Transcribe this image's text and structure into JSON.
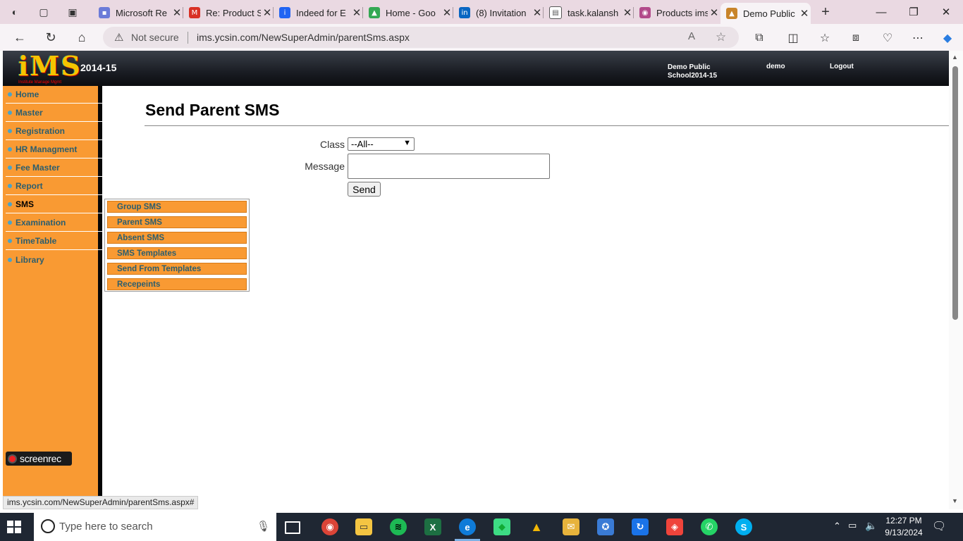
{
  "browser": {
    "tabs": [
      {
        "title": "Microsoft Re",
        "favicon_color": "#6b7bd8"
      },
      {
        "title": "Re: Product S",
        "favicon_color": "#d93025"
      },
      {
        "title": "Indeed for E",
        "favicon_color": "#2164f3"
      },
      {
        "title": "Home - Goo",
        "favicon_color": "#34a853"
      },
      {
        "title": "(8) Invitation",
        "favicon_color": "#0a66c2"
      },
      {
        "title": "task.kalansh",
        "favicon_color": "#555555"
      },
      {
        "title": "Products ims",
        "favicon_color": "#b24a8a"
      },
      {
        "title": "Demo Public",
        "favicon_color": "#c8842a"
      }
    ],
    "close_glyph": "✕",
    "new_tab_glyph": "+",
    "window_controls": {
      "minimize": "—",
      "restore": "❐",
      "close": "✕"
    },
    "address": {
      "warning_glyph": "⚠",
      "security_label": "Not secure",
      "url": "ims.ycsin.com/NewSuperAdmin/parentSms.aspx"
    },
    "nav_glyphs": {
      "back": "←",
      "refresh": "↻",
      "home": "⌂",
      "read_aloud": "A",
      "favorite": "☆"
    },
    "toolbar_glyphs": {
      "extensions": "⧉",
      "split": "◫",
      "favorites": "☆",
      "collections": "⧈",
      "performance": "♡",
      "more": "⋯",
      "copilot": "◆"
    },
    "status_url": "ims.ycsin.com/NewSuperAdmin/parentSms.aspx#"
  },
  "header": {
    "logo_text": "iMS",
    "logo_subtext": "Institute Manage Mgmt",
    "session": "2014-15",
    "school_name": "Demo Public School2014-15",
    "username": "demo",
    "logout_label": "Logout"
  },
  "sidebar": {
    "items": [
      {
        "label": "Home"
      },
      {
        "label": "Master"
      },
      {
        "label": "Registration"
      },
      {
        "label": "HR Managment"
      },
      {
        "label": "Fee Master"
      },
      {
        "label": "Report"
      },
      {
        "label": "SMS",
        "active": true
      },
      {
        "label": "Examination"
      },
      {
        "label": "TimeTable"
      },
      {
        "label": "Library"
      }
    ],
    "submenu": [
      {
        "label": "Group SMS"
      },
      {
        "label": "Parent SMS"
      },
      {
        "label": "Absent SMS"
      },
      {
        "label": "SMS Templates"
      },
      {
        "label": "Send From Templates"
      },
      {
        "label": "Recepeints"
      }
    ]
  },
  "main": {
    "title": "Send Parent SMS",
    "class_label": "Class",
    "class_selected": "--All--",
    "message_label": "Message",
    "message_value": "",
    "send_label": "Send"
  },
  "overlay": {
    "screenrec_label": "screenrec"
  },
  "taskbar": {
    "search_placeholder": "Type here to search",
    "time": "12:27 PM",
    "date": "9/13/2024",
    "apps": [
      {
        "name": "chrome",
        "color": "#db4437",
        "glyph": "◉"
      },
      {
        "name": "file-explorer",
        "color": "#f4c542",
        "glyph": "▭"
      },
      {
        "name": "spotify",
        "color": "#1db954",
        "glyph": "≋"
      },
      {
        "name": "excel",
        "color": "#1d6f42",
        "glyph": "X"
      },
      {
        "name": "edge",
        "color": "#0f7bd8",
        "glyph": "e"
      },
      {
        "name": "android-studio",
        "color": "#3ddc84",
        "glyph": "◆"
      },
      {
        "name": "google-drive",
        "color": "#f2b705",
        "glyph": "▲"
      },
      {
        "name": "mail",
        "color": "#e7b33c",
        "glyph": "✉"
      },
      {
        "name": "badge-app",
        "color": "#3a7bd5",
        "glyph": "✪"
      },
      {
        "name": "sync-app",
        "color": "#1a73e8",
        "glyph": "↻"
      },
      {
        "name": "anydesk",
        "color": "#ef443b",
        "glyph": "◈"
      },
      {
        "name": "whatsapp",
        "color": "#25d366",
        "glyph": "✆"
      },
      {
        "name": "skype",
        "color": "#00aff0",
        "glyph": "S"
      }
    ]
  }
}
